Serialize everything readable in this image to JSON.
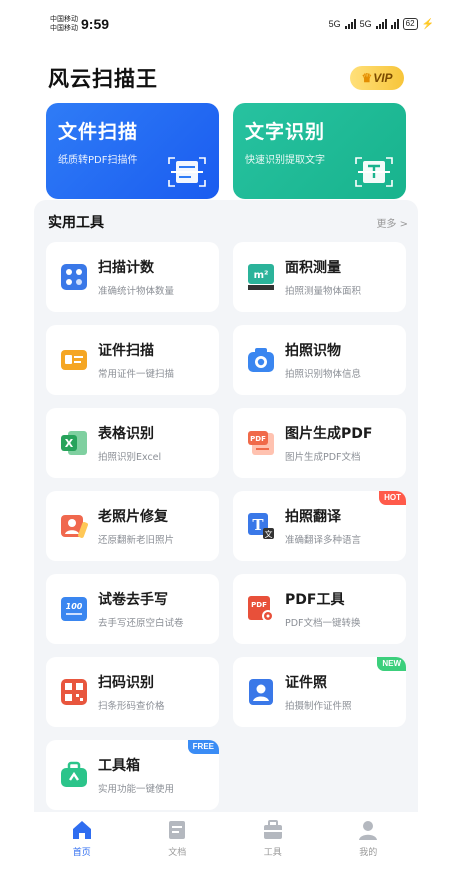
{
  "status_bar": {
    "carrier_1": "中国移动",
    "carrier_2": "中国移动",
    "time": "9:59",
    "signal_1": "5G",
    "signal_2": "5G",
    "battery": "62"
  },
  "header": {
    "title": "风云扫描王",
    "vip_label": "VIP"
  },
  "hero_cards": [
    {
      "title": "文件扫描",
      "subtitle": "纸质转PDF扫描件",
      "icon": "document-scan-icon"
    },
    {
      "title": "文字识别",
      "subtitle": "快速识别提取文字",
      "icon": "text-recognition-icon"
    }
  ],
  "tools_section": {
    "title": "实用工具",
    "more_label": "更多 >"
  },
  "tools": [
    {
      "name": "扫描计数",
      "desc": "准确统计物体数量",
      "icon": "counter-icon",
      "color": "#3a78e8"
    },
    {
      "name": "面积测量",
      "desc": "拍照测量物体面积",
      "icon": "area-measure-icon",
      "icon_text": "m²",
      "color": "#2bb39a"
    },
    {
      "name": "证件扫描",
      "desc": "常用证件一键扫描",
      "icon": "id-card-icon",
      "color": "#f5a623"
    },
    {
      "name": "拍照识物",
      "desc": "拍照识别物体信息",
      "icon": "camera-icon",
      "color": "#3a86f0"
    },
    {
      "name": "表格识别",
      "desc": "拍照识别Excel",
      "icon": "excel-icon",
      "icon_text": "X",
      "color": "#27a35b"
    },
    {
      "name": "图片生成PDF",
      "desc": "图片生成PDF文档",
      "icon": "image-pdf-icon",
      "icon_text": "PDF",
      "color": "#f06a4a"
    },
    {
      "name": "老照片修复",
      "desc": "还原翻新老旧照片",
      "icon": "photo-restore-icon",
      "color": "#f0684e"
    },
    {
      "name": "拍照翻译",
      "desc": "准确翻译多种语言",
      "icon": "translate-icon",
      "icon_text": "T",
      "color": "#3a78e8",
      "tag": "HOT"
    },
    {
      "name": "试卷去手写",
      "desc": "去手写还原空白试卷",
      "icon": "exam-paper-icon",
      "icon_text": "100",
      "color": "#3a86f0"
    },
    {
      "name": "PDF工具",
      "desc": "PDF文档一键转换",
      "icon": "pdf-tool-icon",
      "icon_text": "PDF",
      "color": "#e8503a"
    },
    {
      "name": "扫码识别",
      "desc": "扫条形码查价格",
      "icon": "qr-scan-icon",
      "color": "#e8563e"
    },
    {
      "name": "证件照",
      "desc": "拍摄制作证件照",
      "icon": "id-photo-icon",
      "color": "#3a78e8",
      "tag": "NEW"
    },
    {
      "name": "工具箱",
      "desc": "实用功能一键使用",
      "icon": "toolbox-icon",
      "color": "#2bc48a",
      "tag": "FREE"
    }
  ],
  "tab_bar": [
    {
      "label": "首页",
      "icon": "home-icon",
      "active": true
    },
    {
      "label": "文档",
      "icon": "document-icon",
      "active": false
    },
    {
      "label": "工具",
      "icon": "toolbox-tab-icon",
      "active": false
    },
    {
      "label": "我的",
      "icon": "profile-icon",
      "active": false
    }
  ],
  "colors": {
    "primary": "#2f6df0",
    "accent_green": "#18b38d",
    "panel_bg": "#f3f5f8",
    "vip_gold": "#f7c53a"
  }
}
